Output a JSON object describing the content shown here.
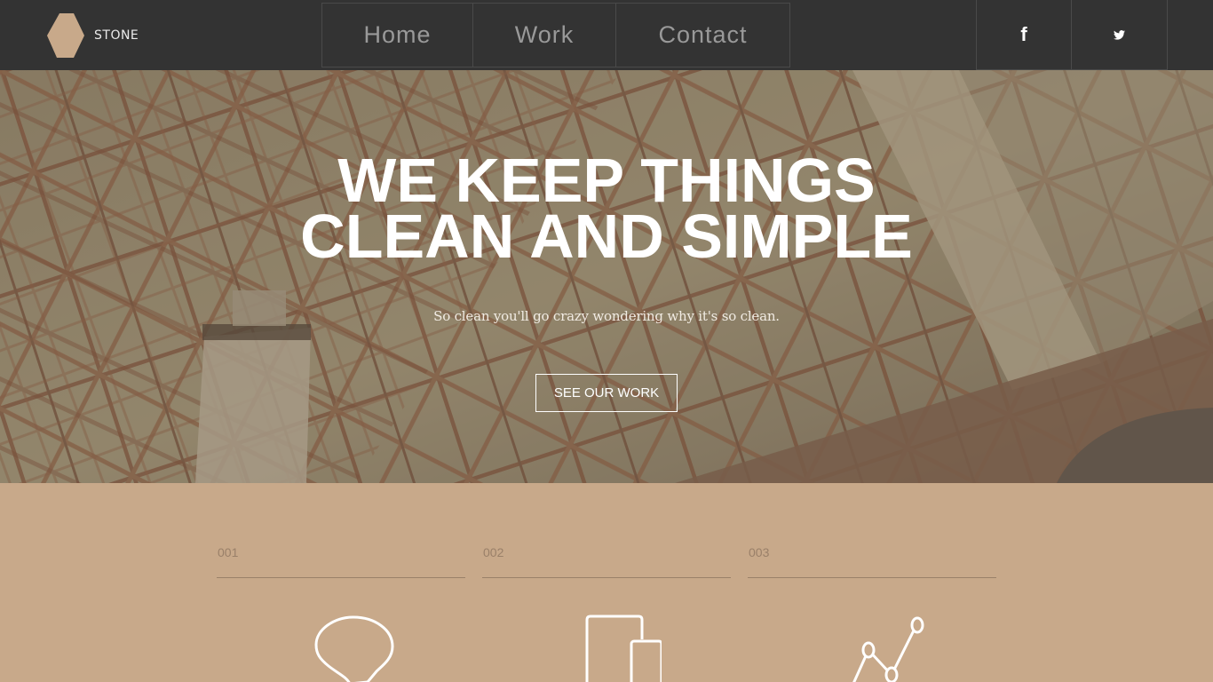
{
  "brand": {
    "name": "STONE",
    "logo_icon": "hexagon-logo-icon",
    "logo_color": "#c8a98a"
  },
  "nav": {
    "items": [
      {
        "label": "Home"
      },
      {
        "label": "Work"
      },
      {
        "label": "Contact"
      }
    ],
    "background": "#333333",
    "text_color": "#999999"
  },
  "social": [
    {
      "name": "facebook",
      "icon": "facebook-icon",
      "glyph": "f"
    },
    {
      "name": "twitter",
      "icon": "twitter-icon"
    }
  ],
  "hero": {
    "title_line1": "WE KEEP THINGS",
    "title_line2": "CLEAN AND SIMPLE",
    "subtitle": "So clean you'll go crazy wondering why it's so clean.",
    "cta_label": "SEE OUR WORK",
    "background_image": "bridge-steel-structure-photo"
  },
  "features": [
    {
      "number": "001",
      "icon": "lightbulb-icon"
    },
    {
      "number": "002",
      "icon": "devices-icon"
    },
    {
      "number": "003",
      "icon": "line-graph-icon"
    }
  ],
  "colors": {
    "accent": "#c8a98a",
    "nav_bg": "#333333",
    "rule": "#9a8069"
  }
}
